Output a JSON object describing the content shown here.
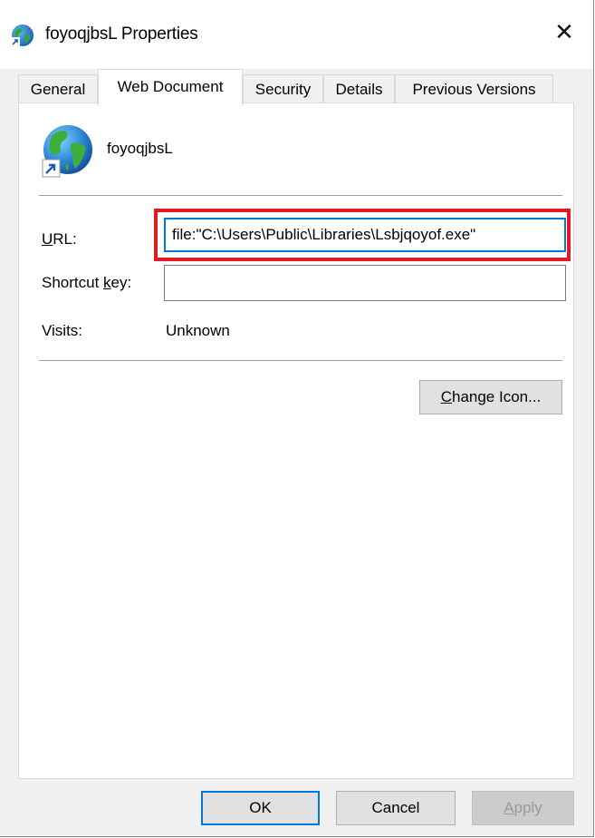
{
  "window": {
    "title": "foyoqjbsL Properties",
    "close_glyph": "✕"
  },
  "tabs": [
    {
      "label": "General",
      "active": false
    },
    {
      "label": "Web Document",
      "active": true
    },
    {
      "label": "Security",
      "active": false
    },
    {
      "label": "Details",
      "active": false
    },
    {
      "label": "Previous Versions",
      "active": false
    }
  ],
  "shortcut": {
    "name": "foyoqjbsL",
    "icon": "globe-shortcut-icon"
  },
  "fields": {
    "url_label_accel": "U",
    "url_label_rest": "RL:",
    "url_value": "file:\"C:\\Users\\Public\\Libraries\\Lsbjqoyof.exe\"",
    "shortcut_label_pre": "Shortcut ",
    "shortcut_label_accel": "k",
    "shortcut_label_post": "ey:",
    "shortcut_value": "",
    "visits_label": "Visits:",
    "visits_value": "Unknown"
  },
  "buttons": {
    "change_icon_accel": "C",
    "change_icon_rest": "hange Icon...",
    "ok": "OK",
    "cancel": "Cancel",
    "apply_accel": "A",
    "apply_rest": "pply"
  },
  "colors": {
    "highlight": "#e01b24",
    "focus": "#0078d7"
  }
}
